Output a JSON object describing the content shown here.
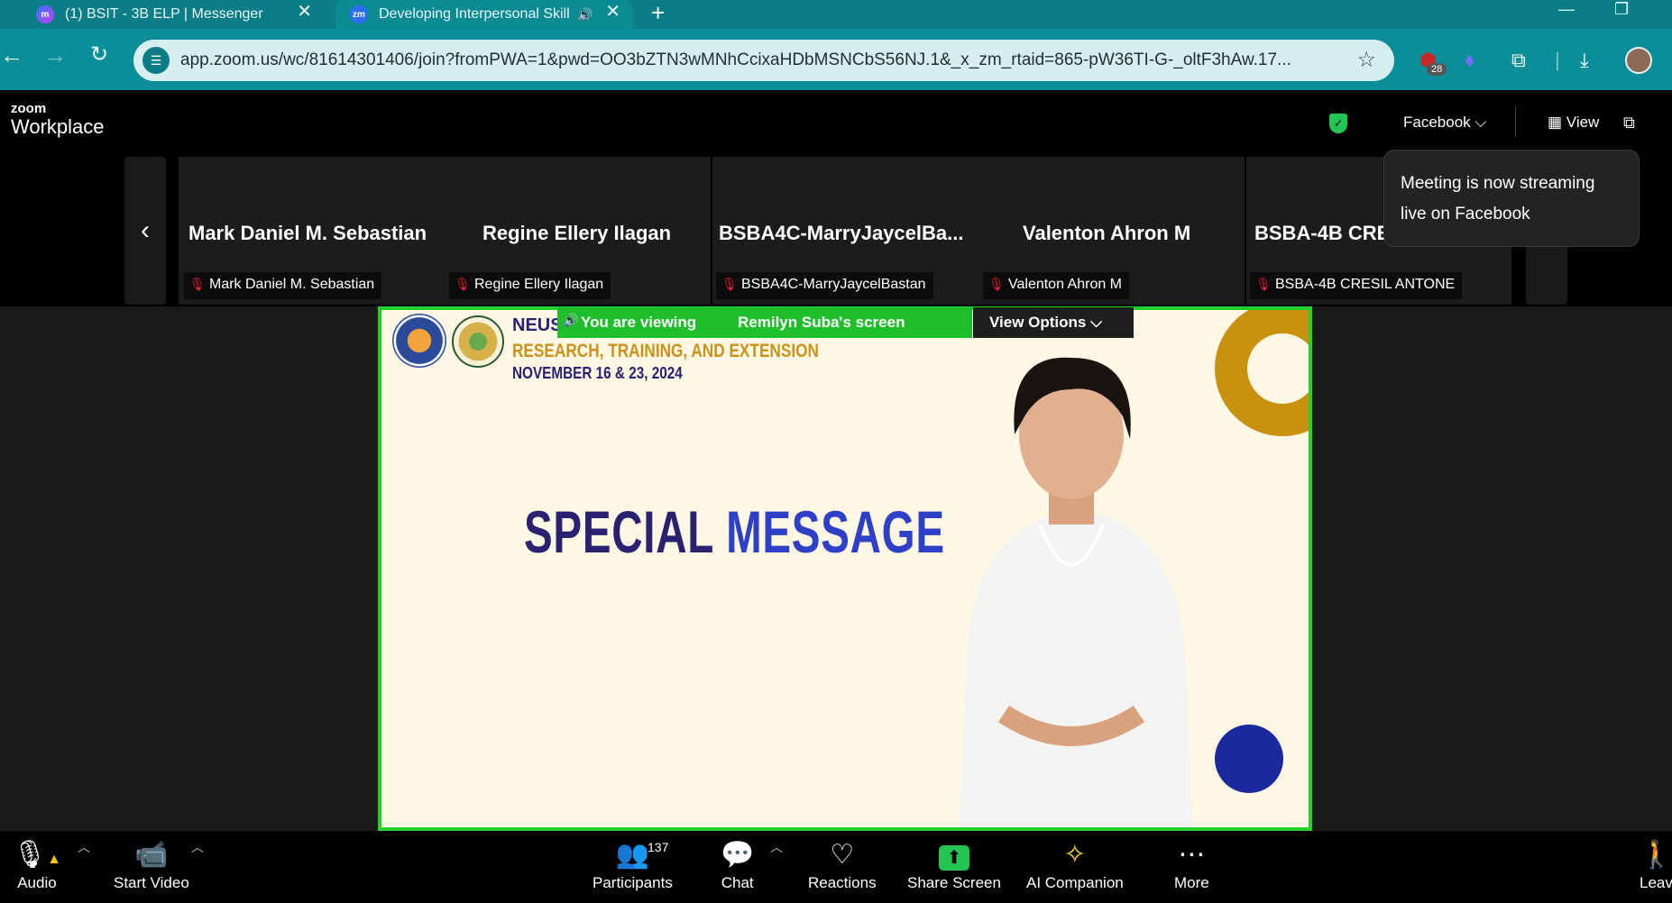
{
  "browser": {
    "tabs": [
      {
        "title": "(1) BSIT - 3B ELP | Messenger",
        "close": "✕"
      },
      {
        "title": "Developing Interpersonal Skill",
        "close": "✕",
        "audio": "🔊"
      }
    ],
    "new_tab": "+",
    "url": "app.zoom.us/wc/81614301406/join?fromPWA=1&pwd=OO3bZTN3wMNhCcixaHDbMSNCbS56NJ.1&_x_zm_rtaid=865-pW36TI-G-_oltF3hAw.17...",
    "extension_badge": "28"
  },
  "zoom": {
    "logo_top": "zoom",
    "logo_bottom": "Workplace",
    "streaming_target": "Facebook",
    "view_label": "View",
    "tooltip": "Meeting is now streaming live on Facebook",
    "participants": [
      {
        "tile_name": "Mark Daniel M. Sebastian",
        "label": "Mark Daniel M. Sebastian"
      },
      {
        "tile_name": "Regine Ellery Ilagan",
        "label": "Regine Ellery Ilagan"
      },
      {
        "tile_name": "BSBA4C-MarryJaycelBa...",
        "label": "BSBA4C-MarryJaycelBastan"
      },
      {
        "tile_name": "Valenton Ahron M",
        "label": "Valenton Ahron M"
      },
      {
        "tile_name": "BSBA-4B CRE",
        "label": "BSBA-4B CRESIL ANTONE"
      }
    ],
    "share_banner": {
      "viewing": "You are viewing",
      "presenter": "Remilyn Suba's screen",
      "view_options": "View Options"
    },
    "slide": {
      "org": "NEUST",
      "program": "RESEARCH, TRAINING, AND EXTENSION",
      "dates": "NOVEMBER 16 & 23, 2024",
      "headline_1": "SPECIAL",
      "headline_2": "MESSAGE"
    },
    "toolbar": {
      "audio": "Audio",
      "video": "Start Video",
      "participants": "Participants",
      "participant_count": "137",
      "chat": "Chat",
      "reactions": "Reactions",
      "share": "Share Screen",
      "ai": "AI Companion",
      "more": "More",
      "leave": "Leav"
    }
  }
}
